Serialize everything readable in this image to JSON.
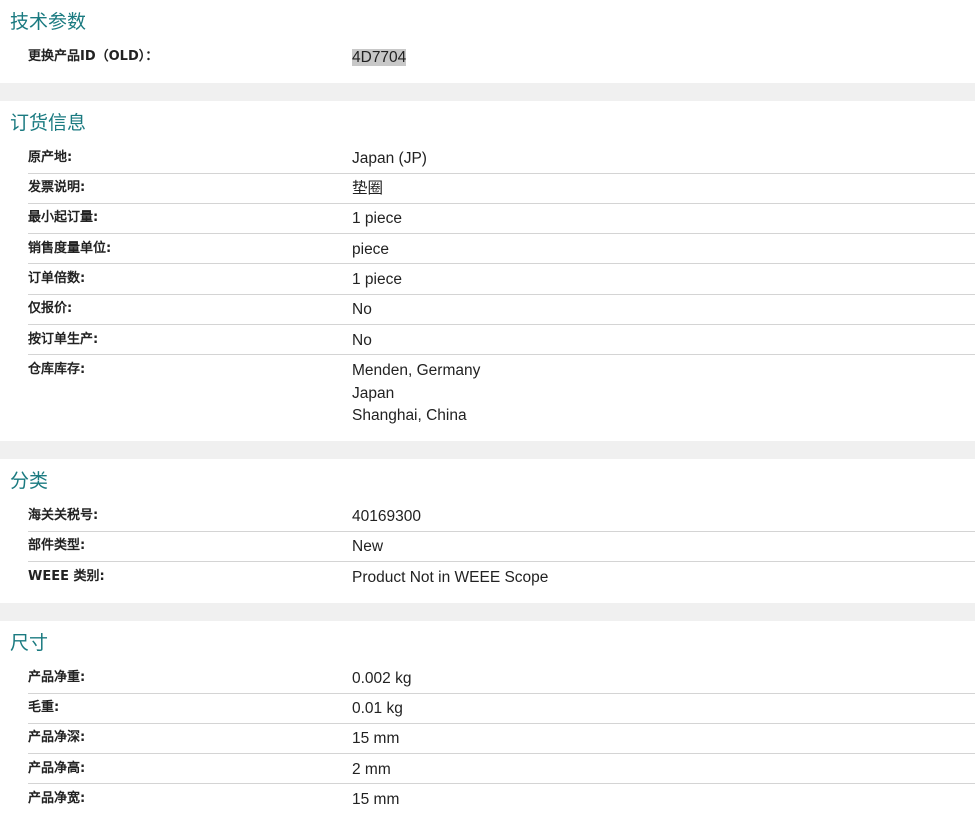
{
  "sections": {
    "tech": {
      "title": "技术参数",
      "rows": [
        {
          "label": "更换产品ID（OLD）：",
          "value": "4D7704"
        }
      ]
    },
    "order": {
      "title": "订货信息",
      "rows": [
        {
          "label": "原产地:",
          "value": "Japan (JP)"
        },
        {
          "label": "发票说明:",
          "value": "垫圈"
        },
        {
          "label": "最小起订量:",
          "value": "1 piece"
        },
        {
          "label": "销售度量单位:",
          "value": "piece"
        },
        {
          "label": "订单倍数:",
          "value": "1 piece"
        },
        {
          "label": "仅报价:",
          "value": "No"
        },
        {
          "label": "按订单生产:",
          "value": "No"
        },
        {
          "label": "仓库库存:",
          "values": [
            "Menden, Germany",
            "Japan",
            "Shanghai, China"
          ]
        }
      ]
    },
    "class": {
      "title": "分类",
      "rows": [
        {
          "label": "海关关税号:",
          "value": "40169300"
        },
        {
          "label": "部件类型:",
          "value": "New"
        },
        {
          "label": "WEEE 类别:",
          "value": "Product Not in WEEE Scope"
        }
      ]
    },
    "dims": {
      "title": "尺寸",
      "rows": [
        {
          "label": "产品净重:",
          "value": "0.002 kg"
        },
        {
          "label": "毛重:",
          "value": "0.01 kg"
        },
        {
          "label": "产品净深:",
          "value": "15 mm"
        },
        {
          "label": "产品净高:",
          "value": "2 mm"
        },
        {
          "label": "产品净宽:",
          "value": "15 mm"
        }
      ]
    }
  }
}
